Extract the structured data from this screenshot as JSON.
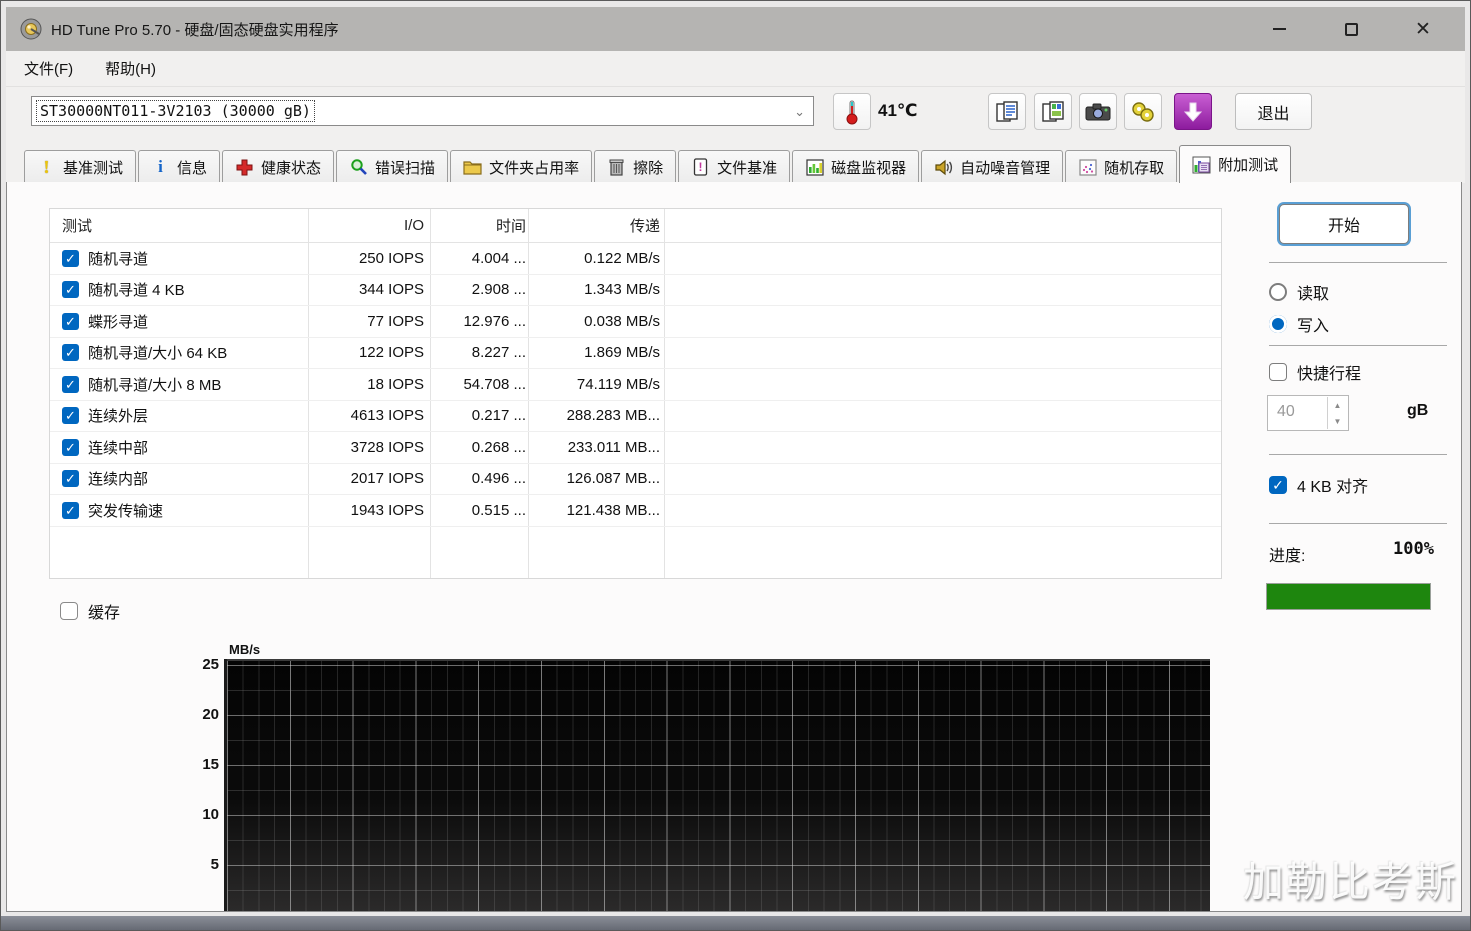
{
  "window": {
    "title": "HD Tune Pro 5.70 - 硬盘/固态硬盘实用程序"
  },
  "menu": {
    "file": "文件(F)",
    "help": "帮助(H)"
  },
  "toolbar": {
    "drive_select_value": "ST30000NT011-3V2103 (30000 gB)",
    "temperature": "41℃",
    "exit_label": "退出"
  },
  "tabs": [
    {
      "label": "基准测试",
      "icon": "benchmark-icon",
      "active": false
    },
    {
      "label": "信息",
      "icon": "info-icon",
      "active": false
    },
    {
      "label": "健康状态",
      "icon": "health-icon",
      "active": false
    },
    {
      "label": "错误扫描",
      "icon": "error-scan-icon",
      "active": false
    },
    {
      "label": "文件夹占用率",
      "icon": "folder-usage-icon",
      "active": false
    },
    {
      "label": "擦除",
      "icon": "erase-icon",
      "active": false
    },
    {
      "label": "文件基准",
      "icon": "file-benchmark-icon",
      "active": false
    },
    {
      "label": "磁盘监视器",
      "icon": "disk-monitor-icon",
      "active": false
    },
    {
      "label": "自动噪音管理",
      "icon": "noise-management-icon",
      "active": false
    },
    {
      "label": "随机存取",
      "icon": "random-access-icon",
      "active": false
    },
    {
      "label": "附加测试",
      "icon": "extra-tests-icon",
      "active": true
    }
  ],
  "results_table": {
    "headers": {
      "test": "测试",
      "io": "I/O",
      "time": "时间",
      "transfer": "传递"
    },
    "rows": [
      {
        "checked": true,
        "test": "随机寻道",
        "io": "250 IOPS",
        "time": "4.004 ...",
        "transfer": "0.122 MB/s"
      },
      {
        "checked": true,
        "test": "随机寻道 4 KB",
        "io": "344 IOPS",
        "time": "2.908 ...",
        "transfer": "1.343 MB/s"
      },
      {
        "checked": true,
        "test": "蝶形寻道",
        "io": "77 IOPS",
        "time": "12.976 ...",
        "transfer": "0.038 MB/s"
      },
      {
        "checked": true,
        "test": "随机寻道/大小 64 KB",
        "io": "122 IOPS",
        "time": "8.227 ...",
        "transfer": "1.869 MB/s"
      },
      {
        "checked": true,
        "test": "随机寻道/大小 8 MB",
        "io": "18 IOPS",
        "time": "54.708 ...",
        "transfer": "74.119 MB/s"
      },
      {
        "checked": true,
        "test": "连续外层",
        "io": "4613 IOPS",
        "time": "0.217 ...",
        "transfer": "288.283 MB..."
      },
      {
        "checked": true,
        "test": "连续中部",
        "io": "3728 IOPS",
        "time": "0.268 ...",
        "transfer": "233.011 MB..."
      },
      {
        "checked": true,
        "test": "连续内部",
        "io": "2017 IOPS",
        "time": "0.496 ...",
        "transfer": "126.087 MB..."
      },
      {
        "checked": true,
        "test": "突发传输速",
        "io": "1943 IOPS",
        "time": "0.515 ...",
        "transfer": "121.438 MB..."
      }
    ]
  },
  "cache_checkbox": {
    "label": "缓存",
    "checked": false
  },
  "chart_data": {
    "type": "line",
    "title": "",
    "xlabel": "",
    "ylabel": "MB/s",
    "ylim": [
      0,
      25
    ],
    "yticks": [
      25,
      20,
      15,
      10,
      5
    ],
    "ytick_labels": [
      "25",
      "20",
      "15",
      "10",
      "5"
    ],
    "grid": "on",
    "plot_background": "black gradient",
    "series": [],
    "note": "empty benchmark grid, no data plotted yet"
  },
  "side_panel": {
    "start_button": "开始",
    "mode_radios": [
      {
        "label": "读取",
        "selected": false
      },
      {
        "label": "写入",
        "selected": true
      }
    ],
    "short_stroke": {
      "label": "快捷行程",
      "checked": false,
      "value": "40",
      "unit": "gB"
    },
    "align_checkbox": {
      "label": "4 KB 对齐",
      "checked": true
    },
    "progress": {
      "label": "进度:",
      "value": "100%",
      "percent": 100
    }
  },
  "watermark": "加勒比考斯",
  "colors": {
    "accent_blue": "#0067c0",
    "progress_green": "#1e860e",
    "download_purple": "#9c27b0",
    "titlebar_gray": "#b5b4b2",
    "health_red": "#d42a2a",
    "benchmark_yellow": "#edc60a"
  },
  "check_glyph": "✓"
}
